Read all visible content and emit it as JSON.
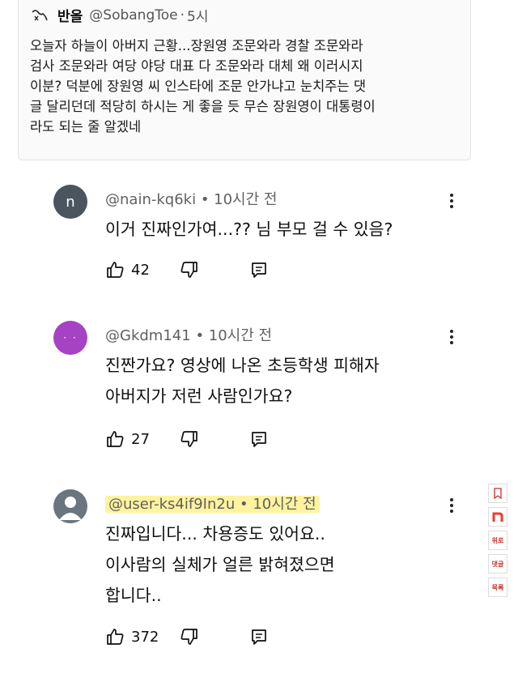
{
  "tweet": {
    "name": "반올",
    "handle": "@SobangToe",
    "separator": "·",
    "time": "5시",
    "lines": [
      "오늘자 하늘이 아버지 근황...장원영 조문와라 경찰 조문와라",
      "검사 조문와라 여당 야당 대표 다 조문와라 대체 왜 이러시지",
      "이분? 덕분에 장원영 씨 인스타에 조문 안가냐고 눈치주는 댓",
      "글 달리던데 적당히 하시는 게 좋을 듯 무슨 장원영이 대통령이",
      "라도 되는 줄 알겠네"
    ]
  },
  "comments": [
    {
      "avatar_letter": "n",
      "avatar_color": "#4a5560",
      "author": "@nain-kq6ki",
      "time": "10시간 전",
      "lines": [
        "이거 진짜인가여...?? 님 부모 걸 수 있음?"
      ],
      "likes": "42"
    },
    {
      "avatar_letter": "· ·",
      "avatar_color": "#a543c4",
      "author": "@Gkdm141",
      "time": "10시간 전",
      "lines": [
        "진짠가요? 영상에 나온 초등학생 피해자",
        "아버지가 저런 사람인가요?"
      ],
      "likes": "27"
    },
    {
      "avatar_letter": "",
      "avatar_color": "#6b7580",
      "author": "@user-ks4if9In2u",
      "time": "10시간 전",
      "lines": [
        "진짜입니다... 차용증도 있어요..",
        "이사람의 실체가 얼른 밝혀졌으면",
        "합니다.."
      ],
      "likes": "372"
    }
  ],
  "sidebar": {
    "items": [
      "",
      "",
      "위로",
      "댓글",
      "목록"
    ]
  },
  "colors": {
    "highlight": "#fff3a0",
    "side_accent": "#e8402c"
  }
}
